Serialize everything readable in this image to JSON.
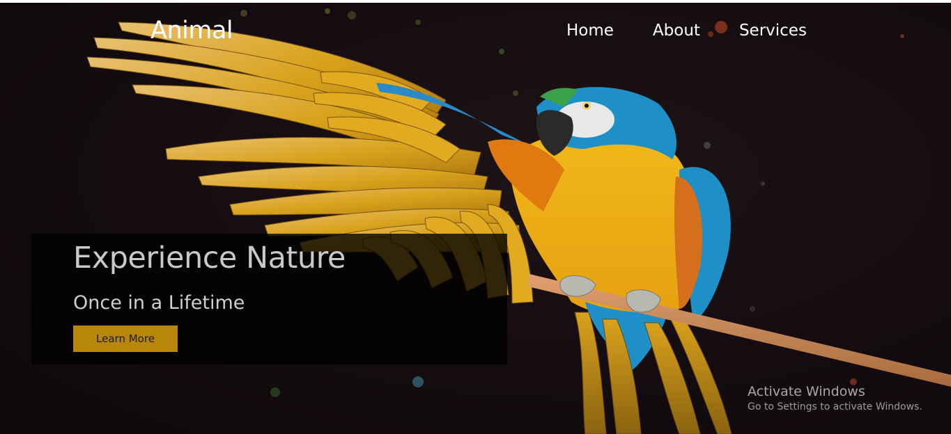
{
  "navbar": {
    "brand": "Animal",
    "links": [
      {
        "label": "Home"
      },
      {
        "label": "About"
      },
      {
        "label": "Services"
      }
    ]
  },
  "hero": {
    "image_icon": "macaw-parrot-photo",
    "title": "Experience Nature",
    "subtitle": "Once in a Lifetime",
    "button_label": "Learn More"
  },
  "watermark": {
    "title": "Activate Windows",
    "subtitle": "Go to Settings to activate Windows."
  },
  "colors": {
    "background": "#140c10",
    "button": "#b8860b",
    "caption_overlay": "rgba(0,0,0,0.78)",
    "nav_text": "#ffffff"
  }
}
